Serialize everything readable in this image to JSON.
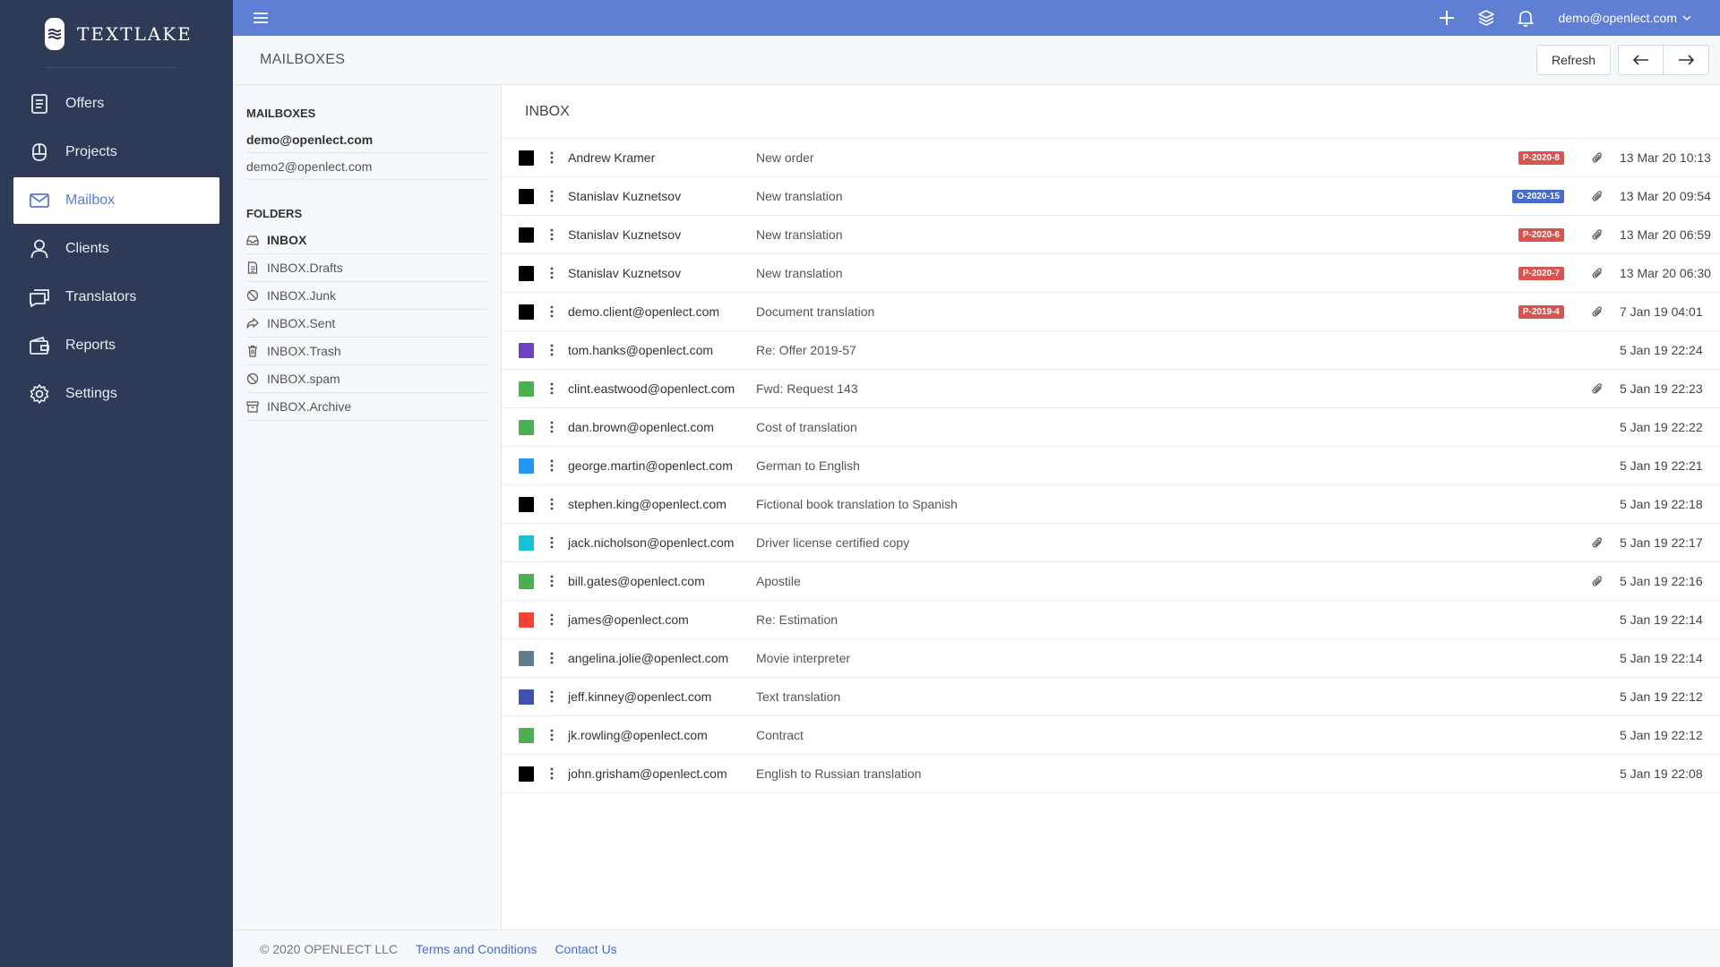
{
  "brand": {
    "name": "TEXTLAKE"
  },
  "nav": [
    {
      "label": "Offers",
      "icon": "document-icon"
    },
    {
      "label": "Projects",
      "icon": "projects-icon"
    },
    {
      "label": "Mailbox",
      "icon": "mail-icon",
      "active": true
    },
    {
      "label": "Clients",
      "icon": "user-icon"
    },
    {
      "label": "Translators",
      "icon": "chat-icon"
    },
    {
      "label": "Reports",
      "icon": "wallet-icon"
    },
    {
      "label": "Settings",
      "icon": "gear-icon"
    }
  ],
  "topbar": {
    "user": "demo@openlect.com"
  },
  "subheader": {
    "title": "MAILBOXES",
    "refresh_label": "Refresh"
  },
  "mailboxes": {
    "heading": "MAILBOXES",
    "items": [
      {
        "label": "demo@openlect.com",
        "active": true
      },
      {
        "label": "demo2@openlect.com",
        "active": false
      }
    ]
  },
  "folders": {
    "heading": "FOLDERS",
    "items": [
      {
        "label": "INBOX",
        "icon": "inbox-icon",
        "active": true
      },
      {
        "label": "INBOX.Drafts",
        "icon": "draft-icon"
      },
      {
        "label": "INBOX.Junk",
        "icon": "block-icon"
      },
      {
        "label": "INBOX.Sent",
        "icon": "share-icon"
      },
      {
        "label": "INBOX.Trash",
        "icon": "trash-icon"
      },
      {
        "label": "INBOX.spam",
        "icon": "block-icon"
      },
      {
        "label": "INBOX.Archive",
        "icon": "archive-icon"
      }
    ]
  },
  "inbox": {
    "title": "INBOX",
    "messages": [
      {
        "color": "#000000",
        "sender": "Andrew Kramer",
        "subject": "New order",
        "badge": "P-2020-8",
        "badge_color": "#d9534f",
        "attachment": true,
        "date": "13 Mar 20 10:13"
      },
      {
        "color": "#000000",
        "sender": "Stanislav Kuznetsov",
        "subject": "New translation",
        "badge": "O-2020-15",
        "badge_color": "#4a6cc9",
        "attachment": true,
        "date": "13 Mar 20 09:54"
      },
      {
        "color": "#000000",
        "sender": "Stanislav Kuznetsov",
        "subject": "New translation",
        "badge": "P-2020-6",
        "badge_color": "#d9534f",
        "attachment": true,
        "date": "13 Mar 20 06:59"
      },
      {
        "color": "#000000",
        "sender": "Stanislav Kuznetsov",
        "subject": "New translation",
        "badge": "P-2020-7",
        "badge_color": "#d9534f",
        "attachment": true,
        "date": "13 Mar 20 06:30"
      },
      {
        "color": "#000000",
        "sender": "demo.client@openlect.com",
        "subject": "Document translation",
        "badge": "P-2019-4",
        "badge_color": "#d9534f",
        "attachment": true,
        "date": "7 Jan 19 04:01"
      },
      {
        "color": "#6f42c1",
        "sender": "tom.hanks@openlect.com",
        "subject": "Re: Offer 2019-57",
        "badge": "",
        "attachment": false,
        "date": "5 Jan 19 22:24"
      },
      {
        "color": "#4caf50",
        "sender": "clint.eastwood@openlect.com",
        "subject": "Fwd: Request 143",
        "badge": "",
        "attachment": true,
        "date": "5 Jan 19 22:23"
      },
      {
        "color": "#4caf50",
        "sender": "dan.brown@openlect.com",
        "subject": "Cost of translation",
        "badge": "",
        "attachment": false,
        "date": "5 Jan 19 22:22"
      },
      {
        "color": "#2196f3",
        "sender": "george.martin@openlect.com",
        "subject": "German to English",
        "badge": "",
        "attachment": false,
        "date": "5 Jan 19 22:21"
      },
      {
        "color": "#000000",
        "sender": "stephen.king@openlect.com",
        "subject": "Fictional book translation to Spanish",
        "badge": "",
        "attachment": false,
        "date": "5 Jan 19 22:18"
      },
      {
        "color": "#17c1d6",
        "sender": "jack.nicholson@openlect.com",
        "subject": "Driver license certified copy",
        "badge": "",
        "attachment": true,
        "date": "5 Jan 19 22:17"
      },
      {
        "color": "#4caf50",
        "sender": "bill.gates@openlect.com",
        "subject": "Apostile",
        "badge": "",
        "attachment": true,
        "date": "5 Jan 19 22:16"
      },
      {
        "color": "#f44336",
        "sender": "james@openlect.com",
        "subject": "Re: Estimation",
        "badge": "",
        "attachment": false,
        "date": "5 Jan 19 22:14"
      },
      {
        "color": "#607d8b",
        "sender": "angelina.jolie@openlect.com",
        "subject": "Movie interpreter",
        "badge": "",
        "attachment": false,
        "date": "5 Jan 19 22:14"
      },
      {
        "color": "#3f51b5",
        "sender": "jeff.kinney@openlect.com",
        "subject": "Text translation",
        "badge": "",
        "attachment": false,
        "date": "5 Jan 19 22:12"
      },
      {
        "color": "#4caf50",
        "sender": "jk.rowling@openlect.com",
        "subject": "Contract",
        "badge": "",
        "attachment": false,
        "date": "5 Jan 19 22:12"
      },
      {
        "color": "#000000",
        "sender": "john.grisham@openlect.com",
        "subject": "English to Russian translation",
        "badge": "",
        "attachment": false,
        "date": "5 Jan 19 22:08"
      }
    ]
  },
  "footer": {
    "copyright": "© 2020 OPENLECT LLC",
    "terms": "Terms and Conditions",
    "contact": "Contact Us"
  }
}
